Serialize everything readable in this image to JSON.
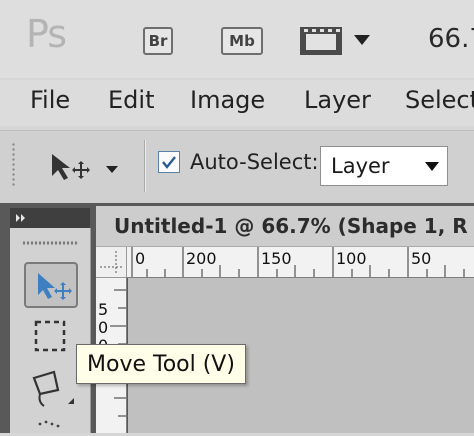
{
  "app": {
    "logo_text": "Ps",
    "bridge_label": "Br",
    "mini_bridge_label": "Mb",
    "zoom": "66.7"
  },
  "menu": {
    "items": [
      "File",
      "Edit",
      "Image",
      "Layer",
      "Select"
    ]
  },
  "options": {
    "auto_select_checked": true,
    "auto_select_label": "Auto-Select:",
    "auto_select_target": "Layer"
  },
  "document": {
    "title": "Untitled-1 @ 66.7% (Shape 1, R",
    "h_ruler_labels": [
      "0",
      "200",
      "150",
      "100",
      "50"
    ],
    "v_ruler_labels": [
      "5",
      "0",
      "0"
    ]
  },
  "tooltip": {
    "text": "Move Tool (V)"
  },
  "colors": {
    "accent": "#3d7fc0",
    "canvas": "#c0c0c0",
    "tooltip_bg": "#fffee8"
  },
  "icons": {
    "bridge": "bridge-icon",
    "mini_bridge": "mini-bridge-icon",
    "workspace": "film-icon",
    "move_tool": "move-tool-icon",
    "marquee": "marquee-icon",
    "lasso": "lasso-icon"
  }
}
